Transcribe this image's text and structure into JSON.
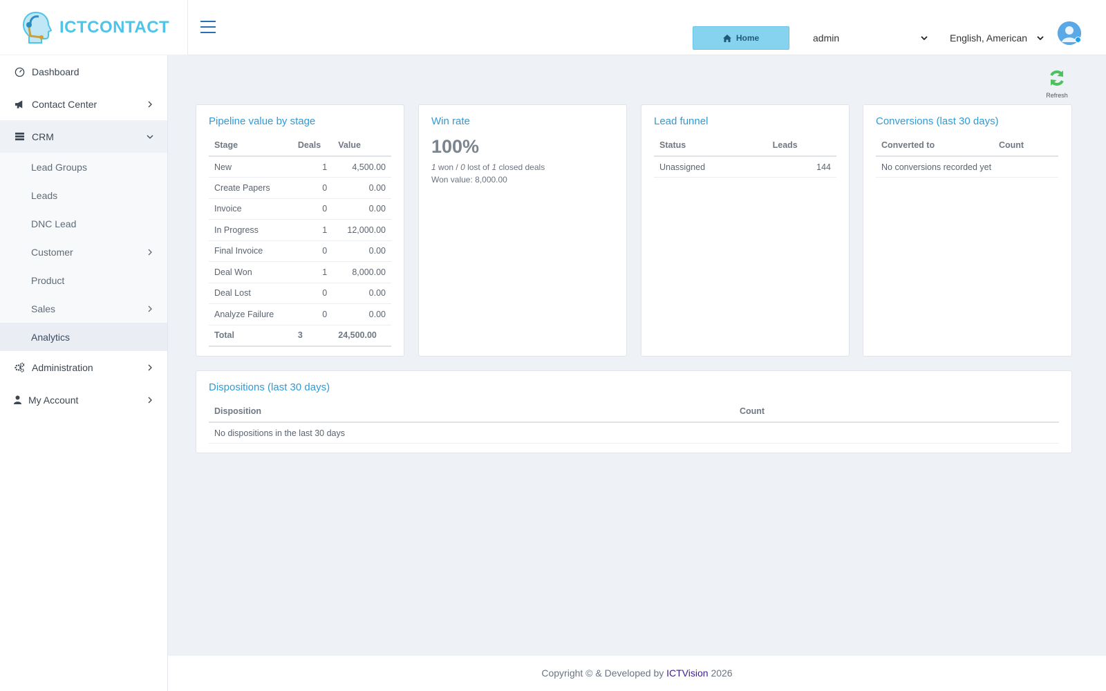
{
  "brand": {
    "logo_text": "ICTCONTACT"
  },
  "sidebar": {
    "items": [
      {
        "label": "Dashboard",
        "icon": "dashboard-gauge-icon"
      },
      {
        "label": "Contact Center",
        "icon": "megaphone-icon"
      },
      {
        "label": "CRM",
        "icon": "crm-list-icon"
      }
    ],
    "crm_sub": [
      {
        "label": "Lead Groups"
      },
      {
        "label": "Leads"
      },
      {
        "label": "DNC Lead"
      },
      {
        "label": "Customer"
      },
      {
        "label": "Product"
      },
      {
        "label": "Sales"
      },
      {
        "label": "Analytics"
      }
    ],
    "bottom": [
      {
        "label": "Administration",
        "icon": "gears-icon"
      },
      {
        "label": "My Account",
        "icon": "user-icon"
      }
    ]
  },
  "topbar": {
    "home_label": "Home",
    "user_select": "admin",
    "language_select": "English, American"
  },
  "refresh_label": "Refresh",
  "pipeline": {
    "title": "Pipeline value by stage",
    "headers": [
      "Stage",
      "Deals",
      "Value"
    ],
    "rows": [
      [
        "New",
        "1",
        "4,500.00"
      ],
      [
        "Create Papers",
        "0",
        "0.00"
      ],
      [
        "Invoice",
        "0",
        "0.00"
      ],
      [
        "In Progress",
        "1",
        "12,000.00"
      ],
      [
        "Final Invoice",
        "0",
        "0.00"
      ],
      [
        "Deal Won",
        "1",
        "8,000.00"
      ],
      [
        "Deal Lost",
        "0",
        "0.00"
      ],
      [
        "Analyze Failure",
        "0",
        "0.00"
      ]
    ],
    "total": [
      "Total",
      "3",
      "24,500.00"
    ]
  },
  "winrate": {
    "title": "Win rate",
    "percent": "100%",
    "won": "1",
    "won_label": "won /",
    "lost": "0",
    "lost_label": "lost of",
    "closed": "1",
    "closed_label": "closed deals",
    "won_value": "Won value: 8,000.00"
  },
  "funnel": {
    "title": "Lead funnel",
    "headers": [
      "Status",
      "Leads"
    ],
    "rows": [
      [
        "Unassigned",
        "144"
      ]
    ]
  },
  "conversions": {
    "title": "Conversions (last 30 days)",
    "headers": [
      "Converted to",
      "Count"
    ],
    "empty": "No conversions recorded yet"
  },
  "dispositions": {
    "title": "Dispositions (last 30 days)",
    "headers": [
      "Disposition",
      "Count"
    ],
    "empty": "No dispositions in the last 30 days"
  },
  "footer": {
    "prefix": "Copyright © & Developed by",
    "brand": "ICTVision",
    "year": "2026"
  },
  "colors": {
    "accent": "#2f9bd6",
    "home_button": "#86d3f0",
    "logo": "#4fc3e8",
    "refresh": "#4cc35a"
  }
}
